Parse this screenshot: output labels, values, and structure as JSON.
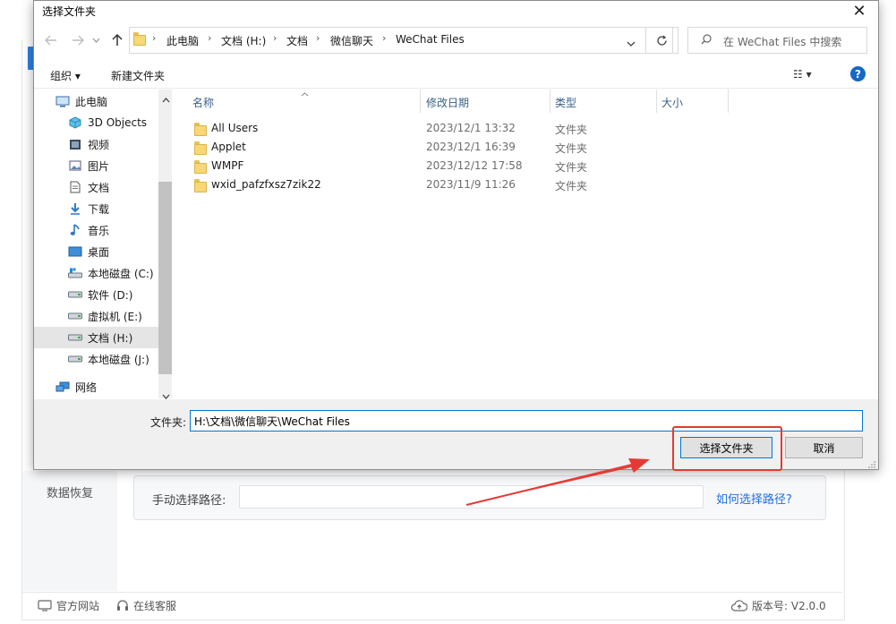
{
  "dialog": {
    "title": "选择文件夹",
    "close_glyph": "✕"
  },
  "address_bar": {
    "crumbs": [
      "此电脑",
      "文档 (H:)",
      "文档",
      "微信聊天",
      "WeChat Files"
    ],
    "search_placeholder": "在 WeChat Files 中搜索"
  },
  "toolbar": {
    "organize_label": "组织 ▾",
    "new_folder_label": "新建文件夹",
    "view_glyph": "☷ ▾",
    "help_glyph": "?"
  },
  "nav_pane": {
    "items": [
      {
        "label": "此电脑",
        "icon": "computer-icon"
      },
      {
        "label": "3D Objects",
        "icon": "cube-icon"
      },
      {
        "label": "视频",
        "icon": "video-icon"
      },
      {
        "label": "图片",
        "icon": "picture-icon"
      },
      {
        "label": "文档",
        "icon": "document-icon"
      },
      {
        "label": "下载",
        "icon": "download-icon"
      },
      {
        "label": "音乐",
        "icon": "music-icon"
      },
      {
        "label": "桌面",
        "icon": "desktop-icon"
      },
      {
        "label": "本地磁盘 (C:)",
        "icon": "system-drive-icon"
      },
      {
        "label": "软件 (D:)",
        "icon": "drive-icon"
      },
      {
        "label": "虚拟机 (E:)",
        "icon": "drive-icon"
      },
      {
        "label": "文档 (H:)",
        "icon": "drive-icon",
        "selected": true
      },
      {
        "label": "本地磁盘 (J:)",
        "icon": "drive-icon"
      },
      {
        "label": "网络",
        "icon": "network-icon"
      }
    ]
  },
  "file_list": {
    "columns": {
      "name": "名称",
      "date": "修改日期",
      "type": "类型",
      "size": "大小"
    },
    "rows": [
      {
        "name": "All Users",
        "date": "2023/12/1 13:32",
        "type": "文件夹"
      },
      {
        "name": "Applet",
        "date": "2023/12/1 16:39",
        "type": "文件夹"
      },
      {
        "name": "WMPF",
        "date": "2023/12/12 17:58",
        "type": "文件夹"
      },
      {
        "name": "wxid_pafzfxsz7zik22",
        "date": "2023/11/9 11:26",
        "type": "文件夹"
      }
    ]
  },
  "bottom": {
    "folder_label": "文件夹:",
    "folder_value": "H:\\文档\\微信聊天\\WeChat Files",
    "select_button": "选择文件夹",
    "cancel_button": "取消"
  },
  "background_app": {
    "sidebar_item": "数据恢复",
    "path_label": "手动选择路径:",
    "help_link": "如何选择路径?",
    "footer": {
      "website": "官方网站",
      "support": "在线客服",
      "version": "版本号: V2.0.0"
    }
  },
  "colors": {
    "accent_blue": "#0078d7",
    "annotation_red": "#e53935",
    "link_blue": "#1f6fde"
  }
}
